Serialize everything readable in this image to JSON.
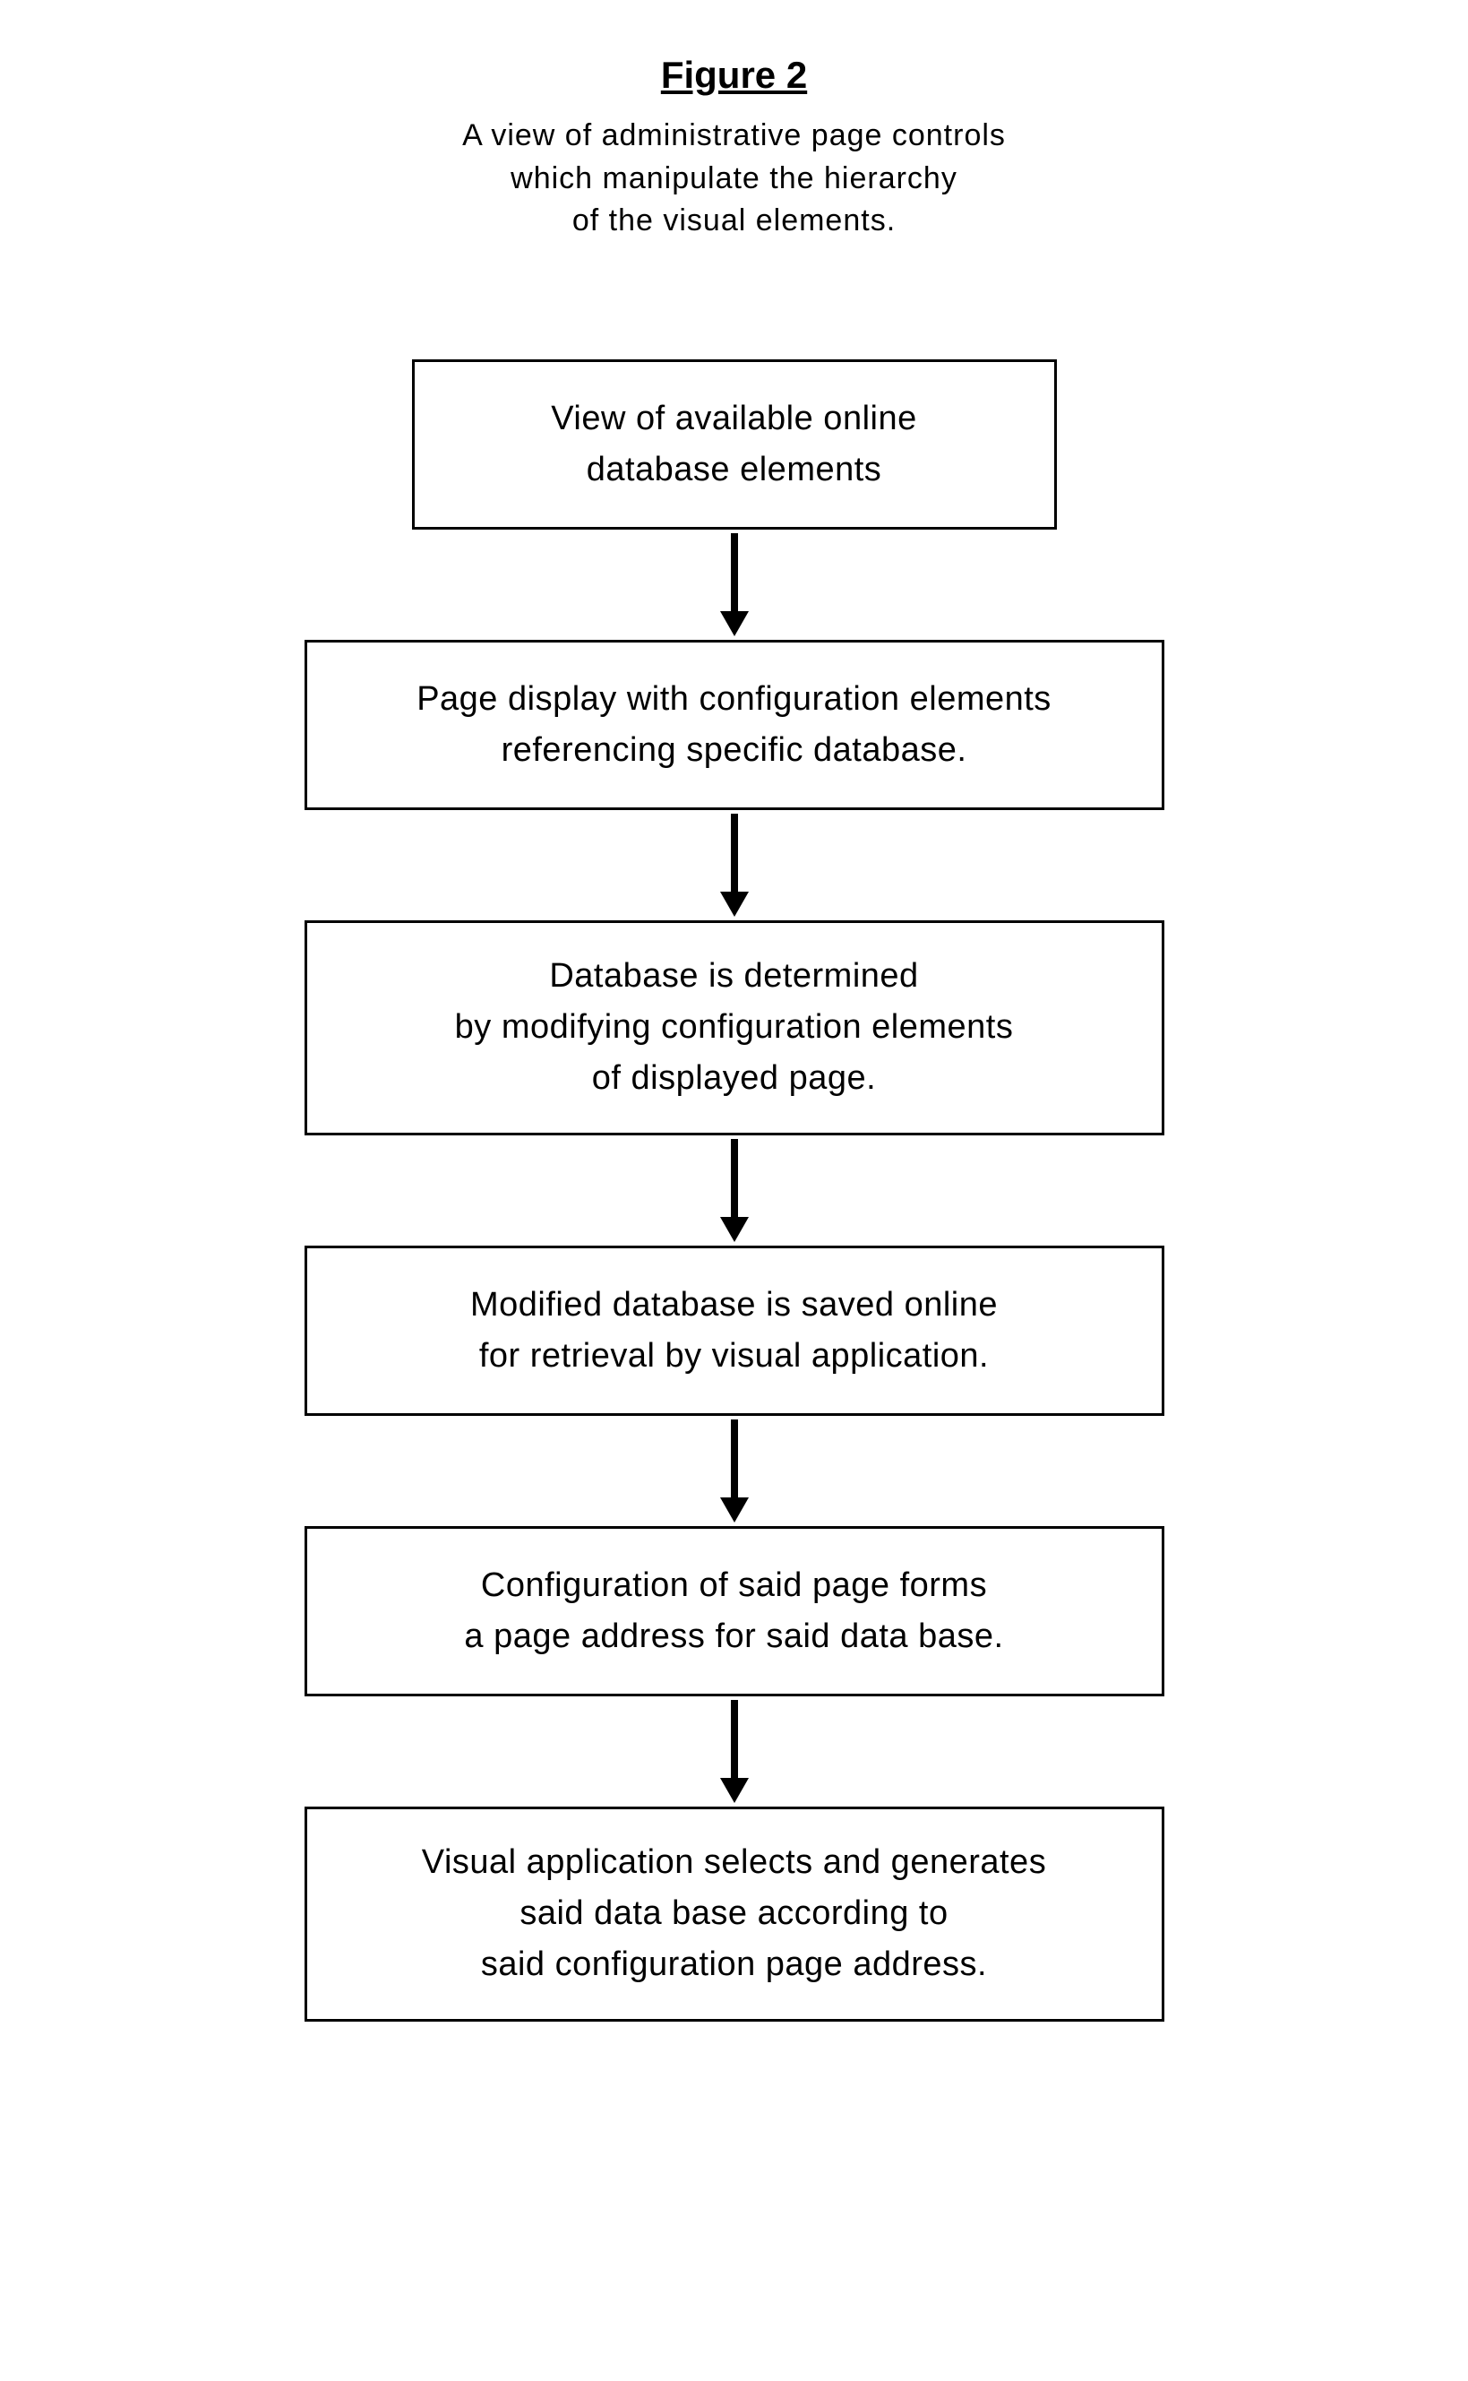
{
  "figure": {
    "title": "Figure 2",
    "caption": "A view of administrative page controls\nwhich manipulate the hierarchy\nof the visual elements."
  },
  "flowchart": {
    "boxes": [
      {
        "text": "View of available online\ndatabase elements"
      },
      {
        "text": "Page display with configuration elements\nreferencing specific database."
      },
      {
        "text": "Database is determined\nby modifying configuration elements\nof displayed page."
      },
      {
        "text": "Modified database is saved online\nfor retrieval by visual application."
      },
      {
        "text": "Configuration of said page forms\na page address for said data base."
      },
      {
        "text": "Visual application selects and generates\nsaid data base according to\nsaid configuration page address."
      }
    ]
  }
}
